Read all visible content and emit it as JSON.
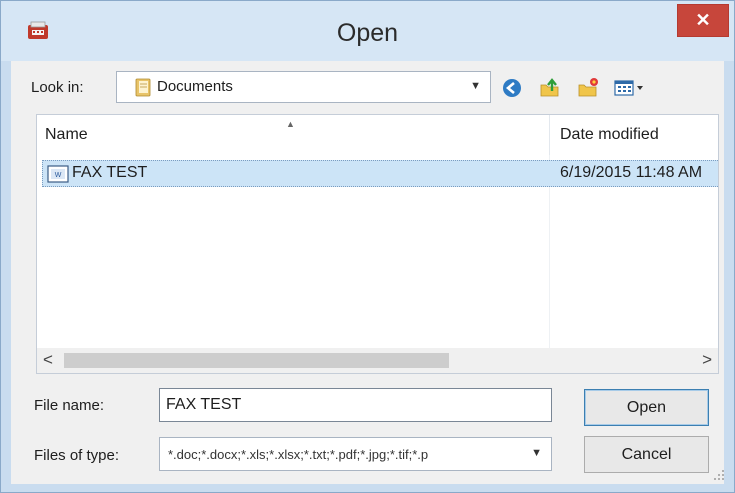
{
  "window": {
    "title": "Open",
    "close_symbol": "✕",
    "app_icon": "app-icon",
    "close_button_color": "#c7463b",
    "title_bar_color": "#d6e6f5"
  },
  "look_in": {
    "label": "Look in:",
    "value": "Documents",
    "folder_icon": "folder-icon"
  },
  "toolbar": {
    "icons": [
      "back-icon",
      "up-folder-icon",
      "new-folder-icon",
      "view-menu-icon"
    ]
  },
  "file_list": {
    "columns": [
      "Name",
      "Date modified"
    ],
    "rows": [
      {
        "name": "FAX TEST",
        "date": "6/19/2015 11:48 AM",
        "icon": "word-document-icon"
      }
    ],
    "selection_color": "#cce4f7"
  },
  "file_name": {
    "label": "File name:",
    "value": "FAX TEST"
  },
  "files_of_type": {
    "label": "Files of type:",
    "value": "*.doc;*.docx;*.xls;*.xlsx;*.txt;*.pdf;*.jpg;*.tif;*.p"
  },
  "buttons": {
    "open": "Open",
    "cancel": "Cancel"
  },
  "scrollbar": {
    "left_arrow": "<",
    "right_arrow": ">"
  }
}
